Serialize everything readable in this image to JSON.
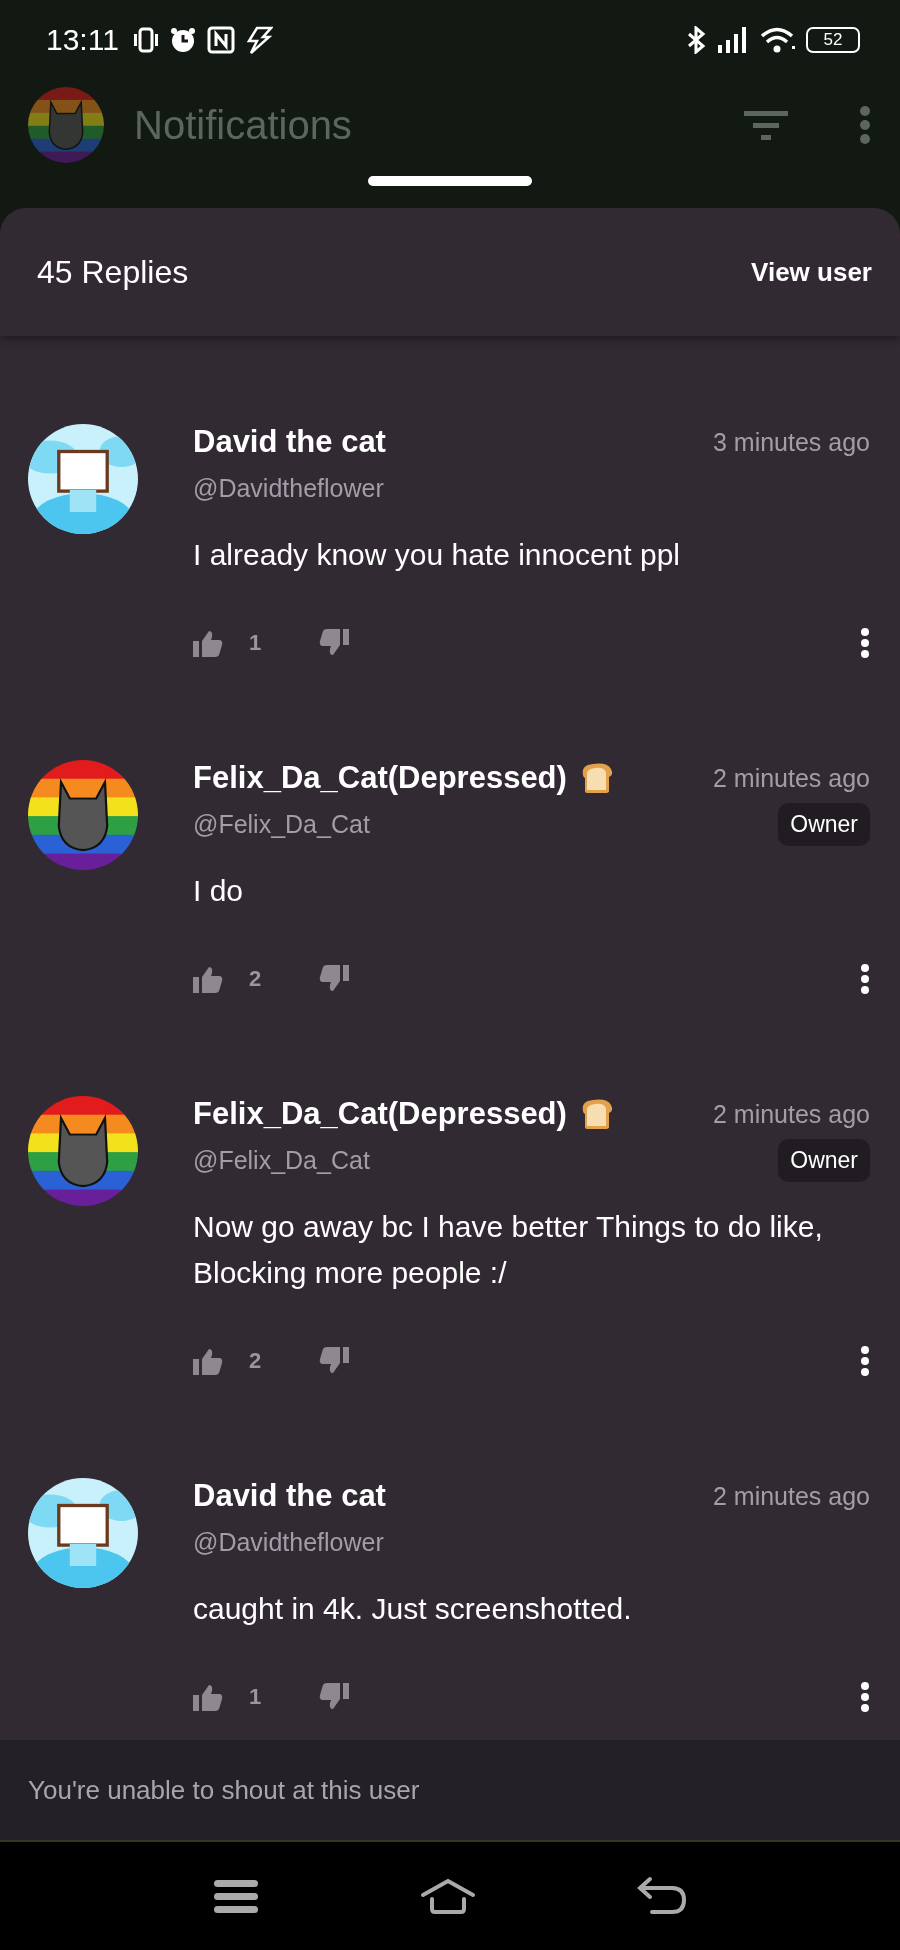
{
  "status_bar": {
    "time": "13:11",
    "battery": "52"
  },
  "background_screen": {
    "title": "Notifications"
  },
  "sheet": {
    "title": "45 Replies",
    "action": "View user"
  },
  "comments": [
    {
      "author": "David the cat",
      "handle": "@Davidtheflower",
      "time": "3 minutes ago",
      "body": "I already know you hate innocent ppl",
      "likes": "1",
      "avatar": {
        "kind": "sky"
      },
      "has_flair": false
    },
    {
      "author": "Felix_Da_Cat(Depressed)",
      "handle": "@Felix_Da_Cat",
      "time": "2 minutes ago",
      "role": "Owner",
      "body": "I do",
      "likes": "2",
      "avatar": {
        "kind": "stripes"
      },
      "has_flair": true
    },
    {
      "author": "Felix_Da_Cat(Depressed)",
      "handle": "@Felix_Da_Cat",
      "time": "2 minutes ago",
      "role": "Owner",
      "body": "Now go away bc I have better Things to do like, Blocking more people :/",
      "likes": "2",
      "avatar": {
        "kind": "stripes"
      },
      "has_flair": true
    },
    {
      "author": "David the cat",
      "handle": "@Davidtheflower",
      "time": "2 minutes ago",
      "body": "caught in 4k. Just screenshotted.",
      "likes": "1",
      "avatar": {
        "kind": "sky"
      },
      "has_flair": false
    }
  ],
  "composer": {
    "notice": "You're unable to shout at this user"
  }
}
